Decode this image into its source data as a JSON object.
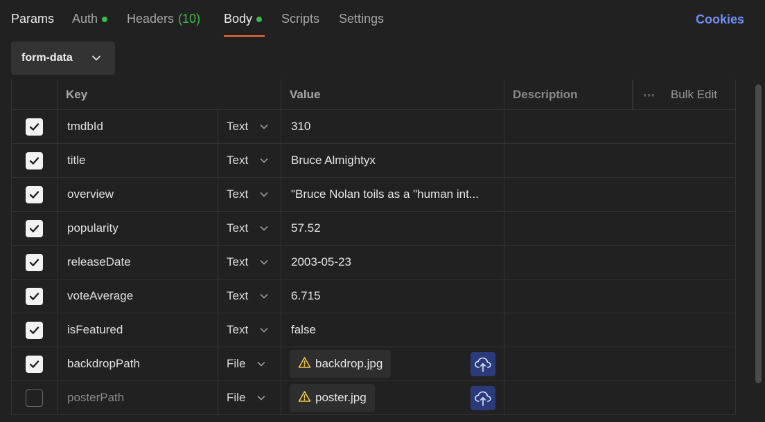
{
  "tabs": {
    "params": "Params",
    "auth": "Auth",
    "headers": "Headers",
    "headers_count": "(10)",
    "body": "Body",
    "scripts": "Scripts",
    "settings": "Settings",
    "cookies": "Cookies"
  },
  "body_mode": {
    "selected": "form-data"
  },
  "table": {
    "headers": {
      "key": "Key",
      "value": "Value",
      "description": "Description",
      "bulk_edit": "Bulk Edit"
    },
    "rows": [
      {
        "checked": true,
        "key": "tmdbId",
        "type": "Text",
        "value": "310"
      },
      {
        "checked": true,
        "key": "title",
        "type": "Text",
        "value": "Bruce Almightyx"
      },
      {
        "checked": true,
        "key": "overview",
        "type": "Text",
        "value": "\"Bruce Nolan toils as a \"human int..."
      },
      {
        "checked": true,
        "key": "popularity",
        "type": "Text",
        "value": "57.52"
      },
      {
        "checked": true,
        "key": "releaseDate",
        "type": "Text",
        "value": "2003-05-23"
      },
      {
        "checked": true,
        "key": "voteAverage",
        "type": "Text",
        "value": "6.715"
      },
      {
        "checked": true,
        "key": "isFeatured",
        "type": "Text",
        "value": "false"
      },
      {
        "checked": true,
        "key": "backdropPath",
        "type": "File",
        "value": "backdrop.jpg"
      },
      {
        "checked": false,
        "key": "posterPath",
        "type": "File",
        "value": "poster.jpg"
      }
    ]
  },
  "colors": {
    "accent_orange": "#ff6c37",
    "status_green": "#3fb950",
    "link_blue": "#6e8ef5",
    "upload_bg": "#2a3a7a",
    "warning_yellow": "#f0c94a"
  },
  "icons": {
    "dropdown": "chevron-down-icon",
    "checkbox": "checkmark-icon",
    "file_warning": "warning-triangle-icon",
    "upload": "cloud-upload-icon",
    "more": "ellipsis-icon"
  }
}
